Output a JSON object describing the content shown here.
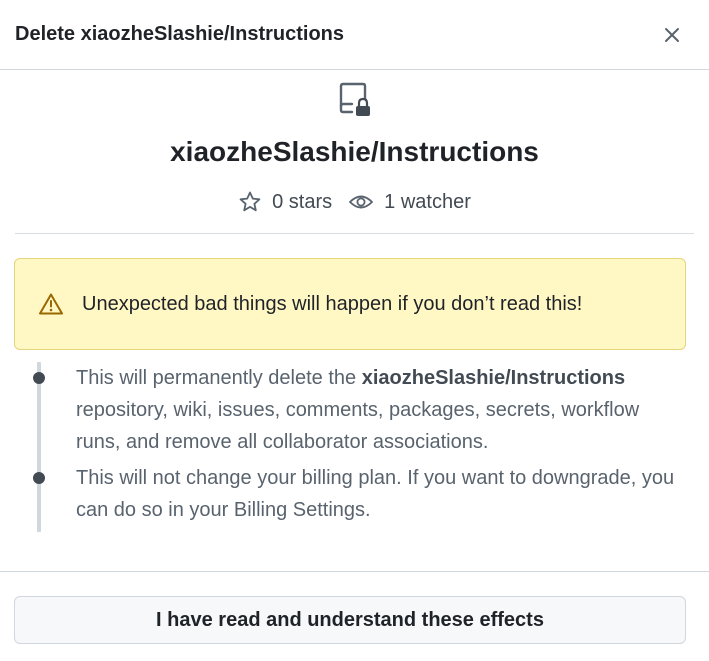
{
  "dialog": {
    "title": "Delete xiaozheSlashie/Instructions",
    "close_icon": "x-icon"
  },
  "repo": {
    "icon": "repo-locked-icon",
    "name": "xiaozheSlashie/Instructions",
    "stars_label": "0 stars",
    "star_icon": "star-icon",
    "watchers_label": "1 watcher",
    "watch_icon": "eye-icon"
  },
  "warning": {
    "icon": "alert-icon",
    "text": "Unexpected bad things will happen if you don’t read this!",
    "background_color": "#fff8c5",
    "icon_color": "#9a6700"
  },
  "effects": [
    {
      "before": "This will permanently delete the ",
      "bold": "xiaozheSlashie/Instructions",
      "after": " repository, wiki, issues, comments, packages, secrets, workflow runs, and remove all collaborator associations."
    },
    {
      "text": "This will not change your billing plan. If you want to downgrade, you can do so in your Billing Settings."
    }
  ],
  "confirm_button": {
    "label": "I have read and understand these effects"
  }
}
